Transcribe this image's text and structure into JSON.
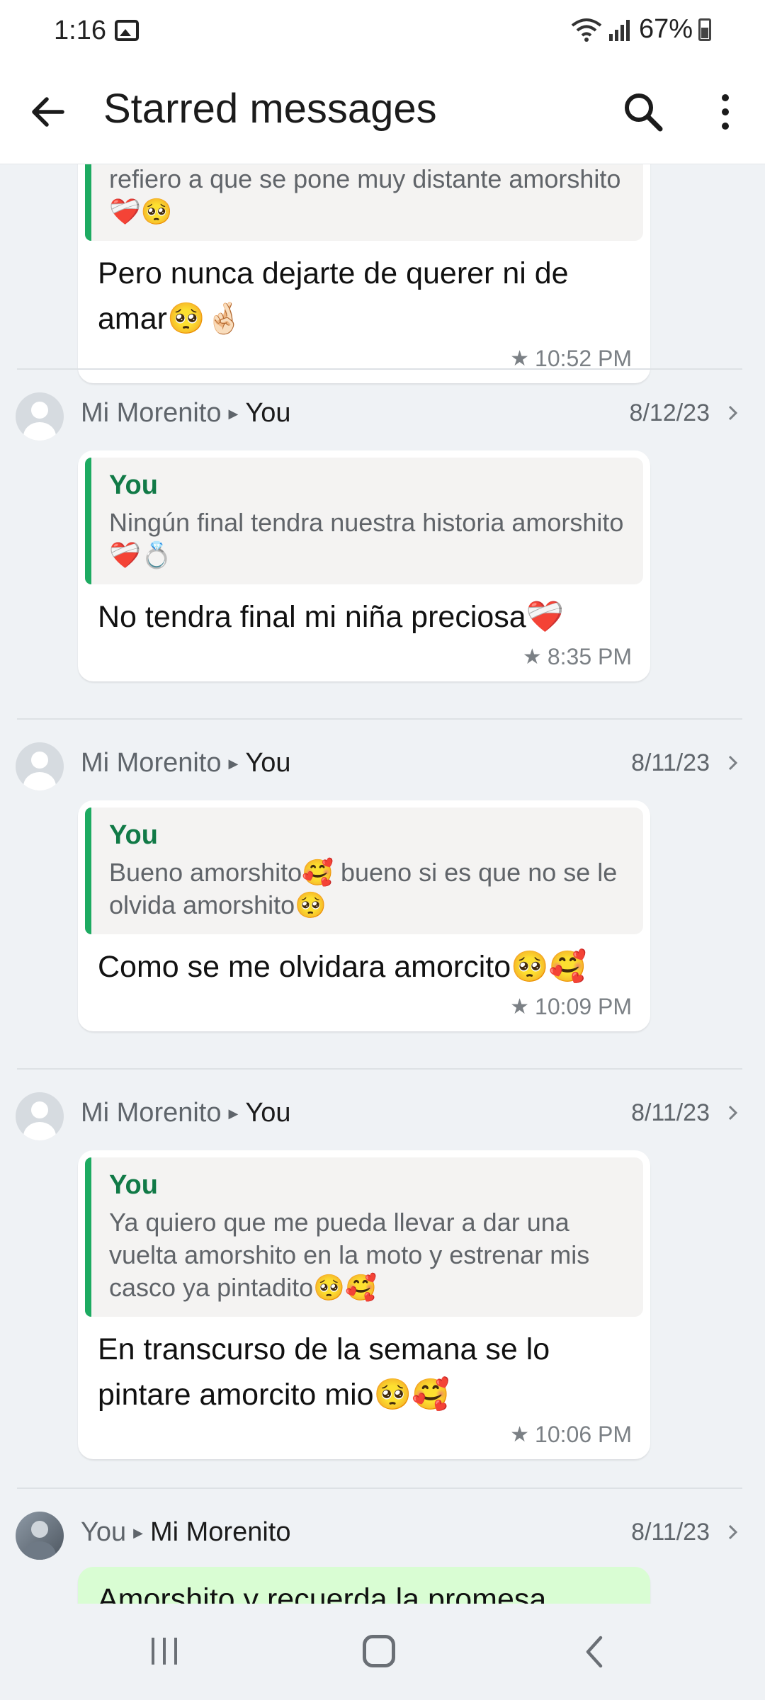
{
  "status": {
    "time": "1:16",
    "battery": "67%"
  },
  "app_bar": {
    "title": "Starred messages"
  },
  "partial_top": {
    "quote_text": "refiero a que se pone muy distante amorshito❤️‍🩹🥺",
    "text": "Pero nunca dejarte de querer ni de amar🥺🤞🏻",
    "time": "10:52 PM"
  },
  "messages": [
    {
      "sender": "Mi Morenito",
      "recipient": "You",
      "date": "8/12/23",
      "quote_author": "You",
      "quote_text": "Ningún final tendra nuestra historia amorshito❤️‍🩹💍",
      "text": "No tendra final mi niña preciosa❤️‍🩹",
      "time": "8:35 PM"
    },
    {
      "sender": "Mi Morenito",
      "recipient": "You",
      "date": "8/11/23",
      "quote_author": "You",
      "quote_text": "Bueno amorshito🥰 bueno si es que no se le olvida amorshito🥺",
      "text": "Como se me olvidara amorcito🥺🥰",
      "time": "10:09 PM"
    },
    {
      "sender": "Mi Morenito",
      "recipient": "You",
      "date": "8/11/23",
      "quote_author": "You",
      "quote_text": "Ya quiero que me pueda llevar a dar una vuelta amorshito en la moto y estrenar mis casco ya pintadito🥺🥰",
      "text": "En transcurso de la semana se lo pintare amorcito mio🥺🥰",
      "time": "10:06 PM"
    },
    {
      "sender": "You",
      "recipient": "Mi Morenito",
      "date": "8/11/23",
      "text": "Amorshito y recuerda la promesa"
    }
  ],
  "icons": {
    "back": "arrow-left-icon",
    "search": "search-icon",
    "more": "more-vert-icon",
    "star": "star-icon",
    "chevron": "chevron-right-icon"
  },
  "colors": {
    "accent": "#1daa61",
    "quote_author": "#117a47",
    "sent_bubble": "#d9fdd3"
  }
}
